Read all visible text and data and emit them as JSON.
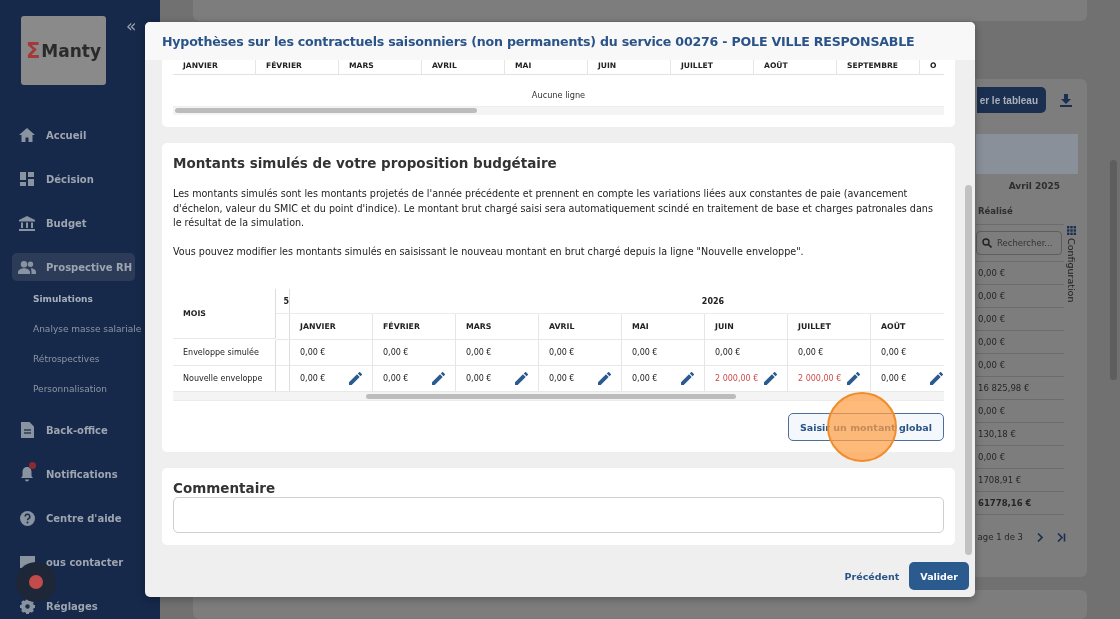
{
  "sidebar": {
    "logo": {
      "symbol": "Σ",
      "name": "Manty"
    },
    "collapse": "«",
    "items": [
      {
        "label": "Accueil",
        "selected": false,
        "alert": false
      },
      {
        "label": "Décision",
        "selected": false,
        "alert": false
      },
      {
        "label": "Budget",
        "selected": false,
        "alert": false
      },
      {
        "label": "Prospective RH",
        "selected": true,
        "alert": false,
        "children": [
          {
            "label": "Simulations",
            "selected": true
          },
          {
            "label": "Analyse masse salariale",
            "selected": false
          },
          {
            "label": "Rétrospectives",
            "selected": false
          },
          {
            "label": "Personnalisation",
            "selected": false
          }
        ]
      },
      {
        "label": "Back-office",
        "selected": false,
        "alert": false
      },
      {
        "label": "Notifications",
        "selected": false,
        "alert": true
      },
      {
        "label": "Centre d'aide",
        "selected": false,
        "alert": false
      },
      {
        "label": "ous contacter",
        "selected": false,
        "alert": false
      },
      {
        "label": "Réglages",
        "selected": false,
        "alert": false
      }
    ]
  },
  "background": {
    "export_button": "er le tableau",
    "column_header": "Avril 2025",
    "subheader": "Réalisé",
    "search_placeholder": "Rechercher...",
    "config_label": "Configuration",
    "values": [
      {
        "text": "0,00 €",
        "total": false
      },
      {
        "text": "0,00 €",
        "total": false
      },
      {
        "text": "0,00 €",
        "total": false
      },
      {
        "text": "0,00 €",
        "total": false
      },
      {
        "text": "0,00 €",
        "total": false
      },
      {
        "text": "16 825,98 €",
        "total": false
      },
      {
        "text": "0,00 €",
        "total": false
      },
      {
        "text": "130,18 €",
        "total": false
      },
      {
        "text": "0,00 €",
        "total": false
      },
      {
        "text": "1708,91 €",
        "total": false
      },
      {
        "text": "61778,16 €",
        "total": true
      }
    ],
    "pagination": "age 1 de 3"
  },
  "modal": {
    "title": "Hypothèses sur les contractuels saisonniers (non permanents) du service 00276 - POLE VILLE RESPONSABLE",
    "first_table": {
      "columns": [
        "JANVIER",
        "FÉVRIER",
        "MARS",
        "AVRIL",
        "MAI",
        "JUIN",
        "JUILLET",
        "AOÛT",
        "SEPTEMBRE",
        "O"
      ],
      "empty_text": "Aucune ligne"
    },
    "section": {
      "heading": "Montants simulés de votre proposition budgétaire",
      "paragraphs": [
        "Les montants simulés sont les montants projetés de l'année précédente et prennent en compte les variations liées aux constantes de paie (avancement d'échelon, valeur du SMIC et du point d'indice). Le montant brut chargé saisi sera automatiquement scindé en traitement de base et charges patronales dans le résultat de la simulation.",
        "Vous pouvez modifier les montants simulés en saisissant le nouveau montant en brut chargé depuis la ligne \"Nouvelle enveloppe\"."
      ],
      "table": {
        "row_header": "MOIS",
        "prev_year": "5",
        "year": "2026",
        "months": [
          "JANVIER",
          "FÉVRIER",
          "MARS",
          "AVRIL",
          "MAI",
          "JUIN",
          "JUILLET",
          "AOÛT"
        ],
        "rows": [
          {
            "label": "Enveloppe simulée",
            "editable": false,
            "cells": [
              {
                "value": "0,00 €",
                "changed": false
              },
              {
                "value": "0,00 €",
                "changed": false
              },
              {
                "value": "0,00 €",
                "changed": false
              },
              {
                "value": "0,00 €",
                "changed": false
              },
              {
                "value": "0,00 €",
                "changed": false
              },
              {
                "value": "0,00 €",
                "changed": false
              },
              {
                "value": "0,00 €",
                "changed": false
              },
              {
                "value": "0,00 €",
                "changed": false
              }
            ]
          },
          {
            "label": "Nouvelle enveloppe",
            "editable": true,
            "cells": [
              {
                "value": "0,00 €",
                "changed": false
              },
              {
                "value": "0,00 €",
                "changed": false
              },
              {
                "value": "0,00 €",
                "changed": false
              },
              {
                "value": "0,00 €",
                "changed": false
              },
              {
                "value": "0,00 €",
                "changed": false
              },
              {
                "value": "2 000,00 €",
                "changed": true
              },
              {
                "value": "2 000,00 €",
                "changed": true
              },
              {
                "value": "0,00 €",
                "changed": false
              }
            ]
          }
        ]
      },
      "global_button": "Saisir un montant global"
    },
    "comment": {
      "heading": "Commentaire"
    },
    "footer": {
      "back": "Précédent",
      "submit": "Valider"
    }
  }
}
